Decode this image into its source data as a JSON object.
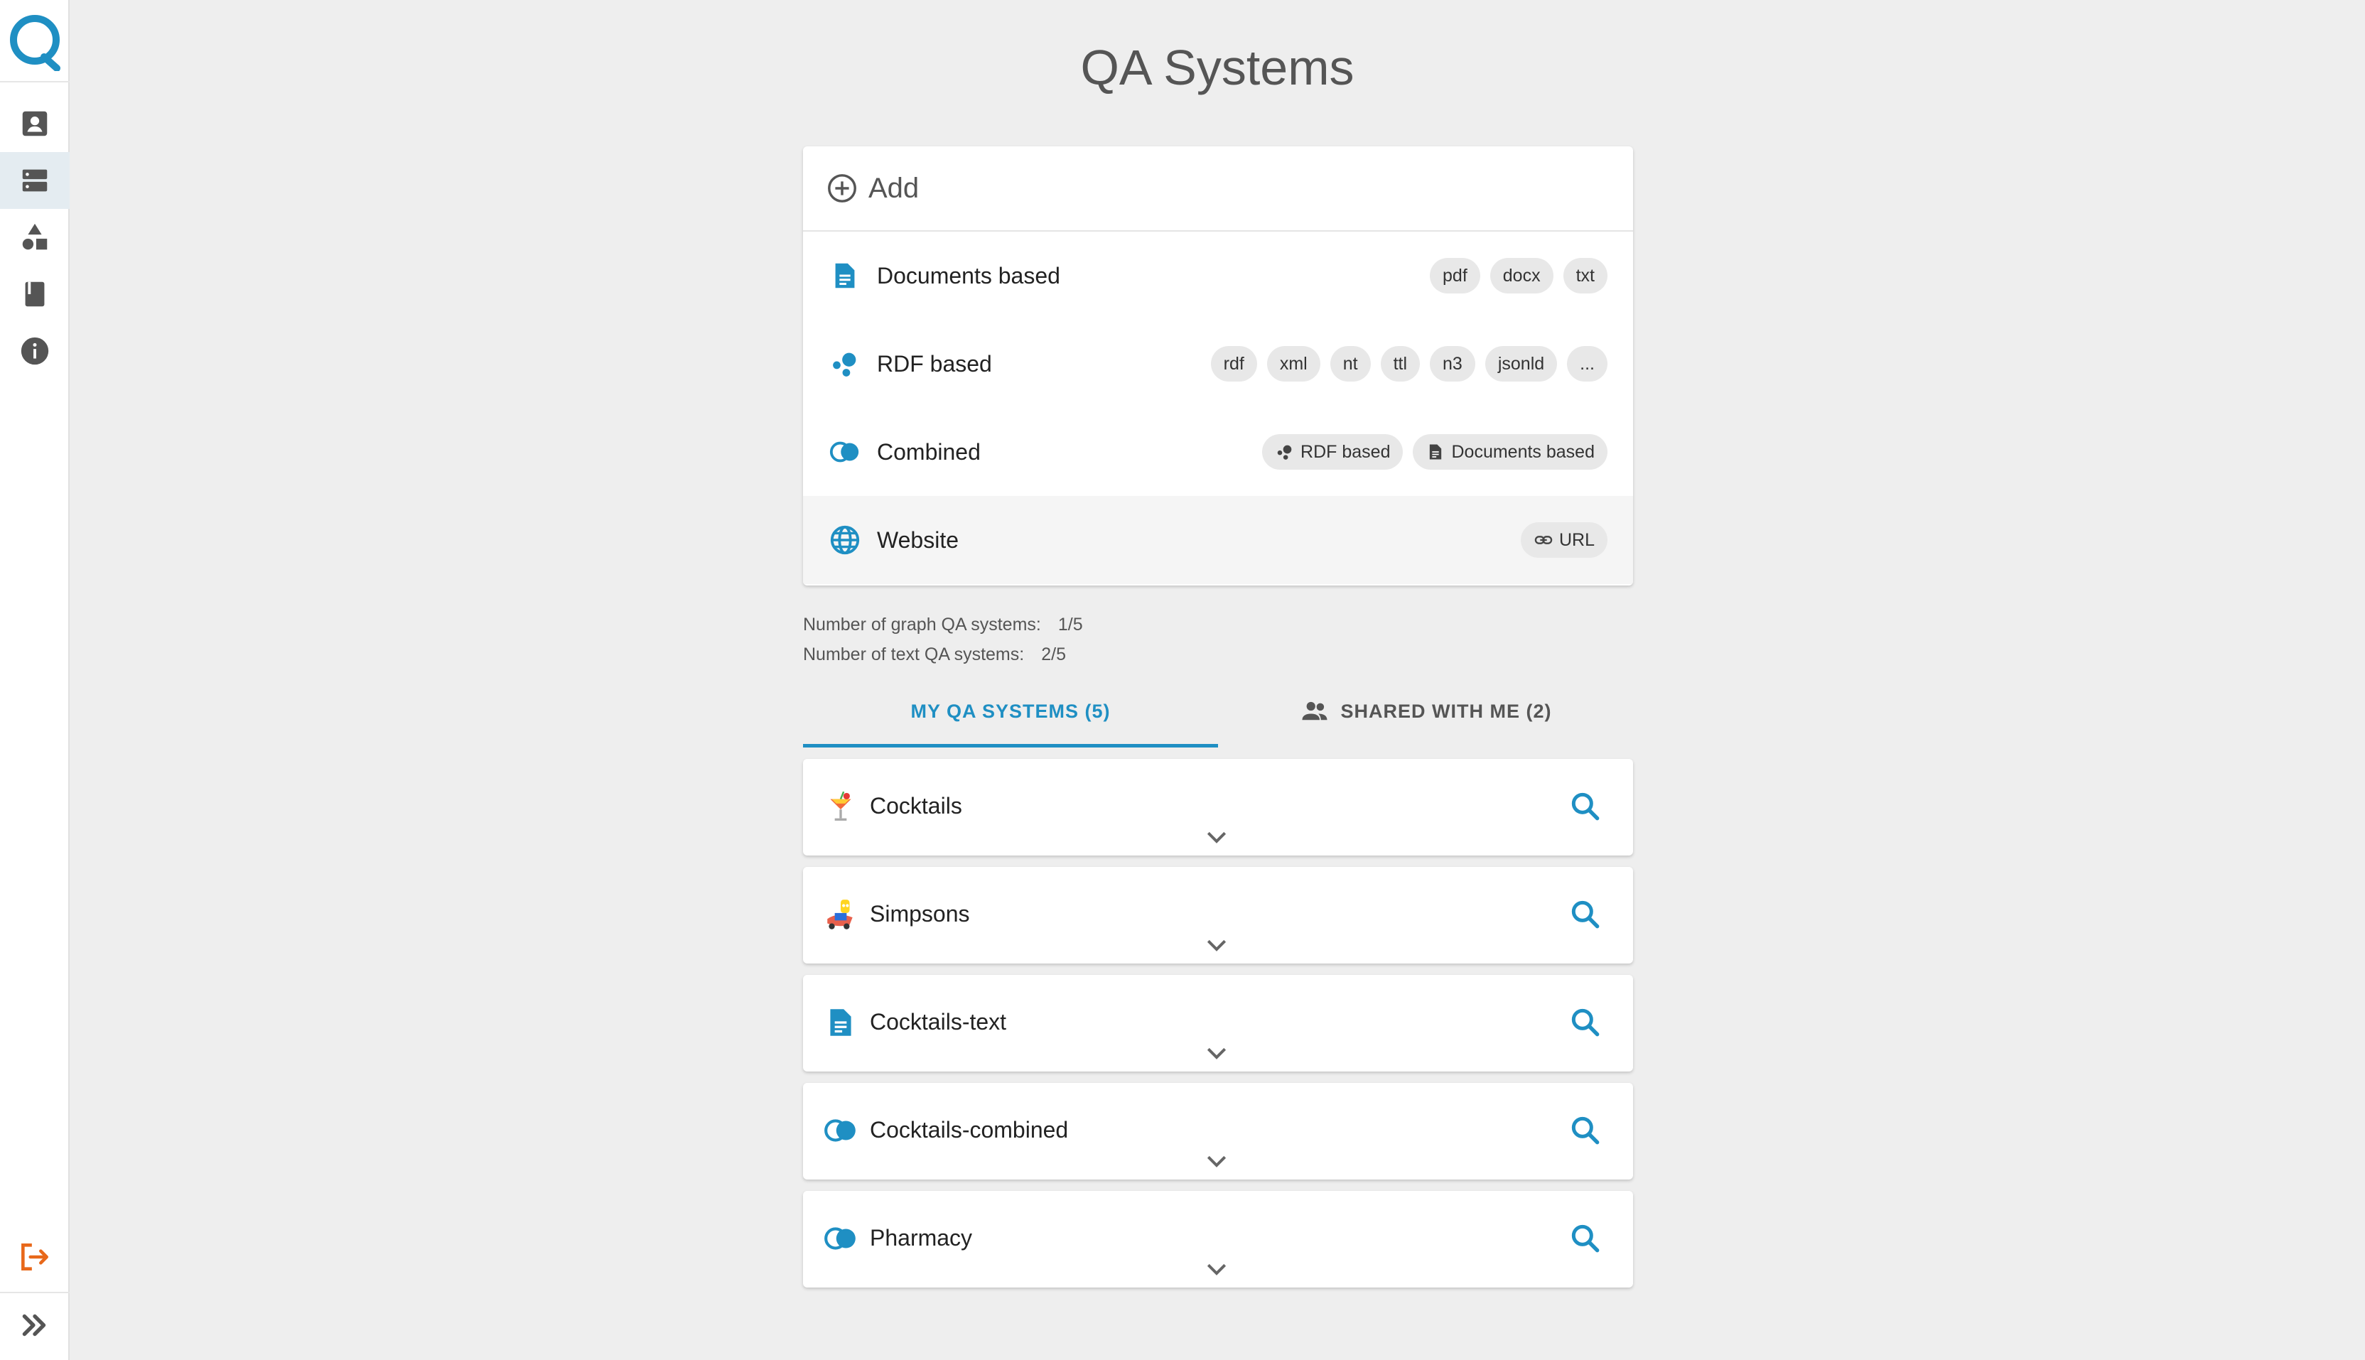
{
  "app": {
    "page_title": "QA Systems",
    "accent_color": "#1f8fc3",
    "logout_color": "#e8681a"
  },
  "sidebar": {
    "items": [
      {
        "icon": "person-card-icon"
      },
      {
        "icon": "server-icon",
        "active": true
      },
      {
        "icon": "shapes-icon"
      },
      {
        "icon": "book-icon"
      },
      {
        "icon": "info-icon"
      }
    ],
    "bottom": [
      {
        "icon": "logout-icon"
      },
      {
        "icon": "expand-icon"
      }
    ]
  },
  "add_panel": {
    "header_label": "Add",
    "types": [
      {
        "label": "Documents based",
        "icon": "document-icon",
        "chips": [
          "pdf",
          "docx",
          "txt"
        ]
      },
      {
        "label": "RDF based",
        "icon": "rdf-bubbles-icon",
        "chips": [
          "rdf",
          "xml",
          "nt",
          "ttl",
          "n3",
          "jsonld",
          "..."
        ]
      },
      {
        "label": "Combined",
        "icon": "combined-circles-icon",
        "chips": [
          "RDF based",
          "Documents based"
        ]
      },
      {
        "label": "Website",
        "icon": "globe-icon",
        "chips": [
          "URL"
        ]
      }
    ]
  },
  "stats": {
    "graph_label": "Number of graph QA systems:",
    "graph_value": "1/5",
    "text_label": "Number of text QA systems:",
    "text_value": "2/5"
  },
  "tabs": {
    "my": "MY QA SYSTEMS (5)",
    "shared": "SHARED WITH ME (2)"
  },
  "qa_systems": [
    {
      "name": "Cocktails",
      "icon": "cocktail-icon"
    },
    {
      "name": "Simpsons",
      "icon": "simpsons-icon"
    },
    {
      "name": "Cocktails-text",
      "icon": "document-icon"
    },
    {
      "name": "Cocktails-combined",
      "icon": "combined-circles-icon"
    },
    {
      "name": "Pharmacy",
      "icon": "combined-circles-icon"
    }
  ]
}
